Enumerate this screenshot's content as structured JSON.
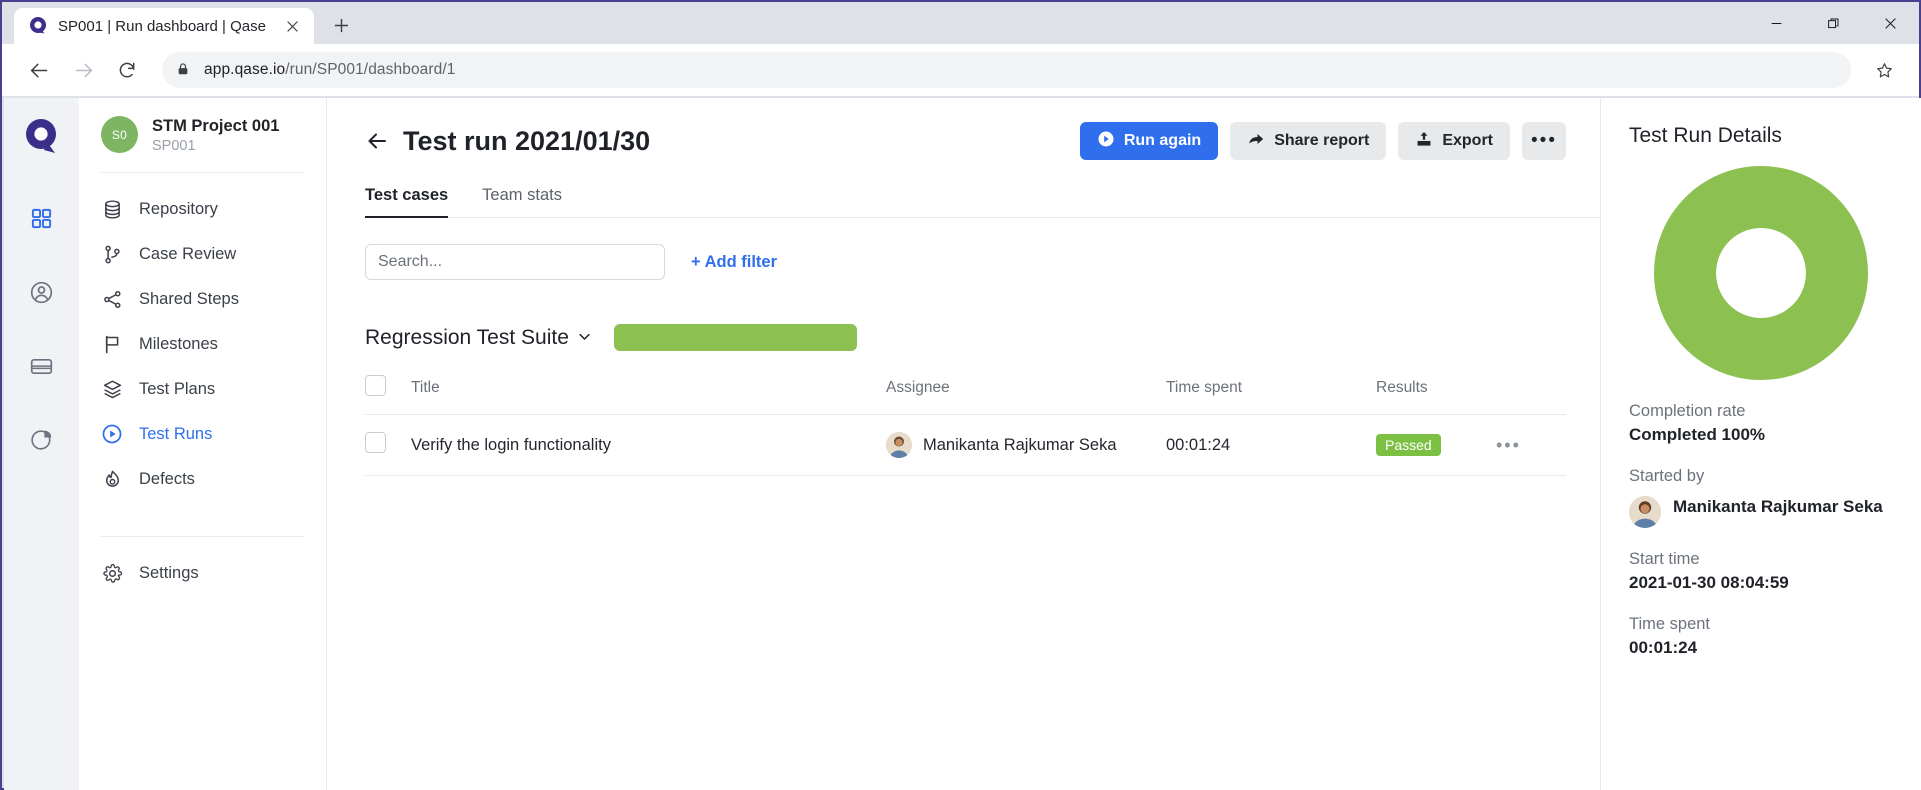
{
  "browser": {
    "tab": {
      "title": "SP001 | Run dashboard | Qase",
      "close_label": "✕"
    },
    "new_tab_label": "+",
    "window_controls": {
      "minimize": "—",
      "restore": "❐",
      "close": "✕"
    },
    "address": {
      "domain": "app.qase.io",
      "path": "/run/SP001/dashboard/1"
    }
  },
  "rail": {
    "items": [
      {
        "icon": "grid-icon",
        "active": true
      },
      {
        "icon": "user-circle-icon",
        "active": false
      },
      {
        "icon": "card-icon",
        "active": false
      },
      {
        "icon": "pie-chart-icon",
        "active": false
      }
    ]
  },
  "sidebar": {
    "project": {
      "avatar_initials": "S0",
      "avatar_color": "#7eb563",
      "name": "STM Project 001",
      "code": "SP001"
    },
    "items": [
      {
        "label": "Repository",
        "icon": "database-icon",
        "active": false
      },
      {
        "label": "Case Review",
        "icon": "branch-icon",
        "active": false
      },
      {
        "label": "Shared Steps",
        "icon": "share-icon",
        "active": false
      },
      {
        "label": "Milestones",
        "icon": "flag-icon",
        "active": false
      },
      {
        "label": "Test Plans",
        "icon": "layers-icon",
        "active": false
      },
      {
        "label": "Test Runs",
        "icon": "play-circle-icon",
        "active": true
      },
      {
        "label": "Defects",
        "icon": "fire-icon",
        "active": false
      }
    ],
    "settings": {
      "label": "Settings",
      "icon": "gear-icon"
    }
  },
  "main": {
    "back_label": "←",
    "page_title": "Test run 2021/01/30",
    "actions": {
      "run_again": "Run again",
      "share_report": "Share report",
      "export": "Export",
      "more": "•••"
    },
    "tabs": [
      {
        "label": "Test cases",
        "active": true
      },
      {
        "label": "Team stats",
        "active": false
      }
    ],
    "search_placeholder": "Search...",
    "add_filter_label": "+ Add filter",
    "suite": {
      "name": "Regression Test Suite",
      "chevron": "⌄",
      "progress_percent": 100,
      "progress_color": "#8cc152"
    },
    "table": {
      "columns": [
        "Title",
        "Assignee",
        "Time spent",
        "Results"
      ],
      "rows": [
        {
          "title": "Verify the login functionality",
          "assignee": "Manikanta Rajkumar Seka",
          "time_spent": "00:01:24",
          "result": "Passed",
          "result_color": "#7bc043",
          "more": "•••"
        }
      ]
    }
  },
  "details": {
    "title": "Test Run Details",
    "completion_label": "Completion rate",
    "completion_value": "Completed 100%",
    "started_by_label": "Started by",
    "started_by_name": "Manikanta Rajkumar Seka",
    "start_time_label": "Start time",
    "start_time_value": "2021-01-30 08:04:59",
    "time_spent_label": "Time spent",
    "time_spent_value": "00:01:24"
  },
  "chart_data": {
    "type": "pie",
    "title": "Test Run Details",
    "labels": [
      "Passed"
    ],
    "values": [
      100
    ],
    "colors": [
      "#8cc152"
    ],
    "total": 100,
    "units": "percent",
    "donut": true,
    "inner_radius_ratio": 0.42,
    "legend": "none"
  }
}
